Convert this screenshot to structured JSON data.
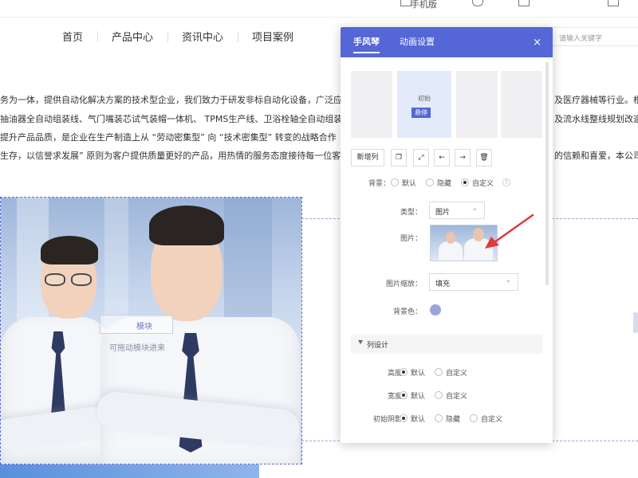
{
  "top_bar": {
    "items": [
      "手机版"
    ]
  },
  "nav": {
    "items": [
      "首页",
      "产品中心",
      "资讯中心",
      "项目案例"
    ]
  },
  "search": {
    "placeholder": "请输入关键字"
  },
  "content": {
    "lines": [
      "务为一体，提供自动化解决方案的技术型企业，我们致力于研发非标自动化设备，广泛应",
      "抽油器全自动组装线、气门嘴装芯试气装帽一体机、 TPMS生产线、卫浴栓轴全自动组装",
      "提升产品品质，是企业在生产制造上从 “劳动密集型” 向 “技术密集型” 转变的战略合作",
      "生存，以信誉求发展” 原则为客户提供质量更好的产品，用热情的服务态度接待每一位客",
      "及医疗器械等行业。根",
      "及流水线整线规划改造",
      "的信赖和喜爱，本公司"
    ],
    "drag_hint": "可拖动模块进来",
    "drag_box_label": "模块"
  },
  "panel": {
    "tabs": [
      "手风琴",
      "动画设置"
    ],
    "close": "×",
    "thumb_label_initial": "初始",
    "thumb_label_hover": "悬停",
    "tools": {
      "add_column": "新增列",
      "copy": "❐",
      "expand": "⤢",
      "left": "←",
      "right": "→",
      "delete": "🗑"
    },
    "background": {
      "label": "背景：",
      "options": [
        "默认",
        "隐藏",
        "自定义"
      ],
      "help": "?"
    },
    "type": {
      "label": "类型：",
      "value": "图片"
    },
    "image": {
      "label": "图片："
    },
    "image_scale": {
      "label": "图片缩放：",
      "value": "填充"
    },
    "bg_color": {
      "label": "背景色：",
      "color": "#9aa4d8"
    },
    "column_design": {
      "title": "列设计",
      "height": {
        "label": "高度：",
        "options": [
          "默认",
          "自定义"
        ]
      },
      "width": {
        "label": "宽度：",
        "options": [
          "默认",
          "自定义"
        ]
      },
      "shadow": {
        "label": "初始阴影：",
        "options": [
          "默认",
          "隐藏",
          "自定义"
        ]
      }
    }
  },
  "colors": {
    "accent": "#5567d6",
    "annotation_arrow": "#e03a3a"
  }
}
